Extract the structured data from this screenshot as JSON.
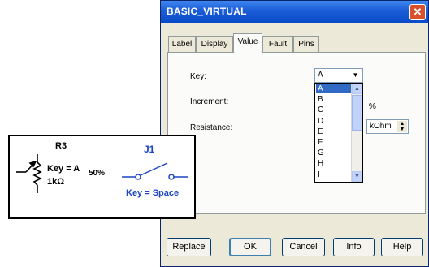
{
  "window": {
    "title": "BASIC_VIRTUAL",
    "close_glyph": "✕"
  },
  "tabs": [
    {
      "label": "Label"
    },
    {
      "label": "Display"
    },
    {
      "label": "Value",
      "active": true
    },
    {
      "label": "Fault"
    },
    {
      "label": "Pins"
    }
  ],
  "form": {
    "key_label": "Key:",
    "key_value": "A",
    "increment_label": "Increment:",
    "increment_unit": "%",
    "resistance_label": "Resistance:",
    "resistance_unit": "kOhm"
  },
  "key_options": [
    "A",
    "B",
    "C",
    "D",
    "E",
    "F",
    "G",
    "H",
    "I"
  ],
  "buttons": {
    "replace": "Replace",
    "ok": "OK",
    "cancel": "Cancel",
    "info": "Info",
    "help": "Help"
  },
  "schematic": {
    "potentiometer": {
      "ref": "R3",
      "key_text": "Key = A",
      "percent": "50%",
      "value": "1kΩ"
    },
    "switch": {
      "ref": "J1",
      "key_text": "Key = Space"
    },
    "colors": {
      "potentiometer": "#000000",
      "switch": "#1c44c4"
    }
  },
  "icons": {
    "dropdown_arrow": "▼",
    "scroll_up": "▲",
    "scroll_down": "▼",
    "spin_up": "▲",
    "spin_down": "▼"
  }
}
